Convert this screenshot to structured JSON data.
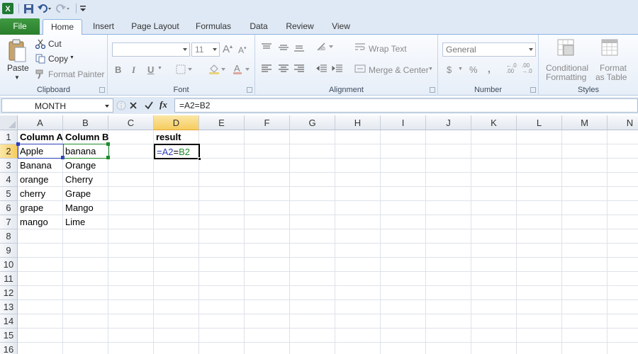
{
  "ribbon": {
    "tabs": {
      "file": "File",
      "home": "Home",
      "insert": "Insert",
      "page_layout": "Page Layout",
      "formulas": "Formulas",
      "data": "Data",
      "review": "Review",
      "view": "View"
    },
    "clipboard": {
      "paste": "Paste",
      "cut": "Cut",
      "copy": "Copy",
      "format_painter": "Format Painter",
      "label": "Clipboard"
    },
    "font": {
      "size": "11",
      "bold": "B",
      "italic": "I",
      "underline": "U",
      "label": "Font"
    },
    "alignment": {
      "wrap_text": "Wrap Text",
      "merge_center": "Merge & Center",
      "label": "Alignment"
    },
    "number": {
      "format": "General",
      "currency": "$",
      "percent": "%",
      "comma": ",",
      "inc_decimal": "←.0\n.00",
      "dec_decimal": ".00\n→.0",
      "label": "Number"
    },
    "styles": {
      "conditional_1": "Conditional",
      "conditional_2": "Formatting",
      "format_1": "Format",
      "format_2": "as Table",
      "label": "Styles"
    }
  },
  "formula_bar": {
    "name_box": "MONTH",
    "fx": "fx",
    "formula": "=A2=B2"
  },
  "grid": {
    "columns": [
      "A",
      "B",
      "C",
      "D",
      "E",
      "F",
      "G",
      "H",
      "I",
      "J",
      "K",
      "L",
      "M",
      "N"
    ],
    "rows": [
      "1",
      "2",
      "3",
      "4",
      "5",
      "6",
      "7",
      "8",
      "9",
      "10",
      "11",
      "12",
      "13",
      "14",
      "15",
      "16"
    ],
    "cells": {
      "A1": "Column A",
      "B1": "Column B",
      "D1": "result",
      "A2": "Apple",
      "B2": "banana",
      "A3": "Banana",
      "B3": "Orange",
      "A4": "orange",
      "B4": "Cherry",
      "A5": "cherry",
      "B5": "Grape",
      "A6": "grape",
      "B6": "Mango",
      "A7": "mango",
      "B7": "Lime",
      "D2_part1": "=A2",
      "D2_part2": "=",
      "D2_part3": "B2"
    },
    "selected_cell": "D2",
    "colors": {
      "ref_a2": "#2b3eb8",
      "ref_b2": "#1e8a2a",
      "header_selected": "#f6cc5e"
    }
  }
}
